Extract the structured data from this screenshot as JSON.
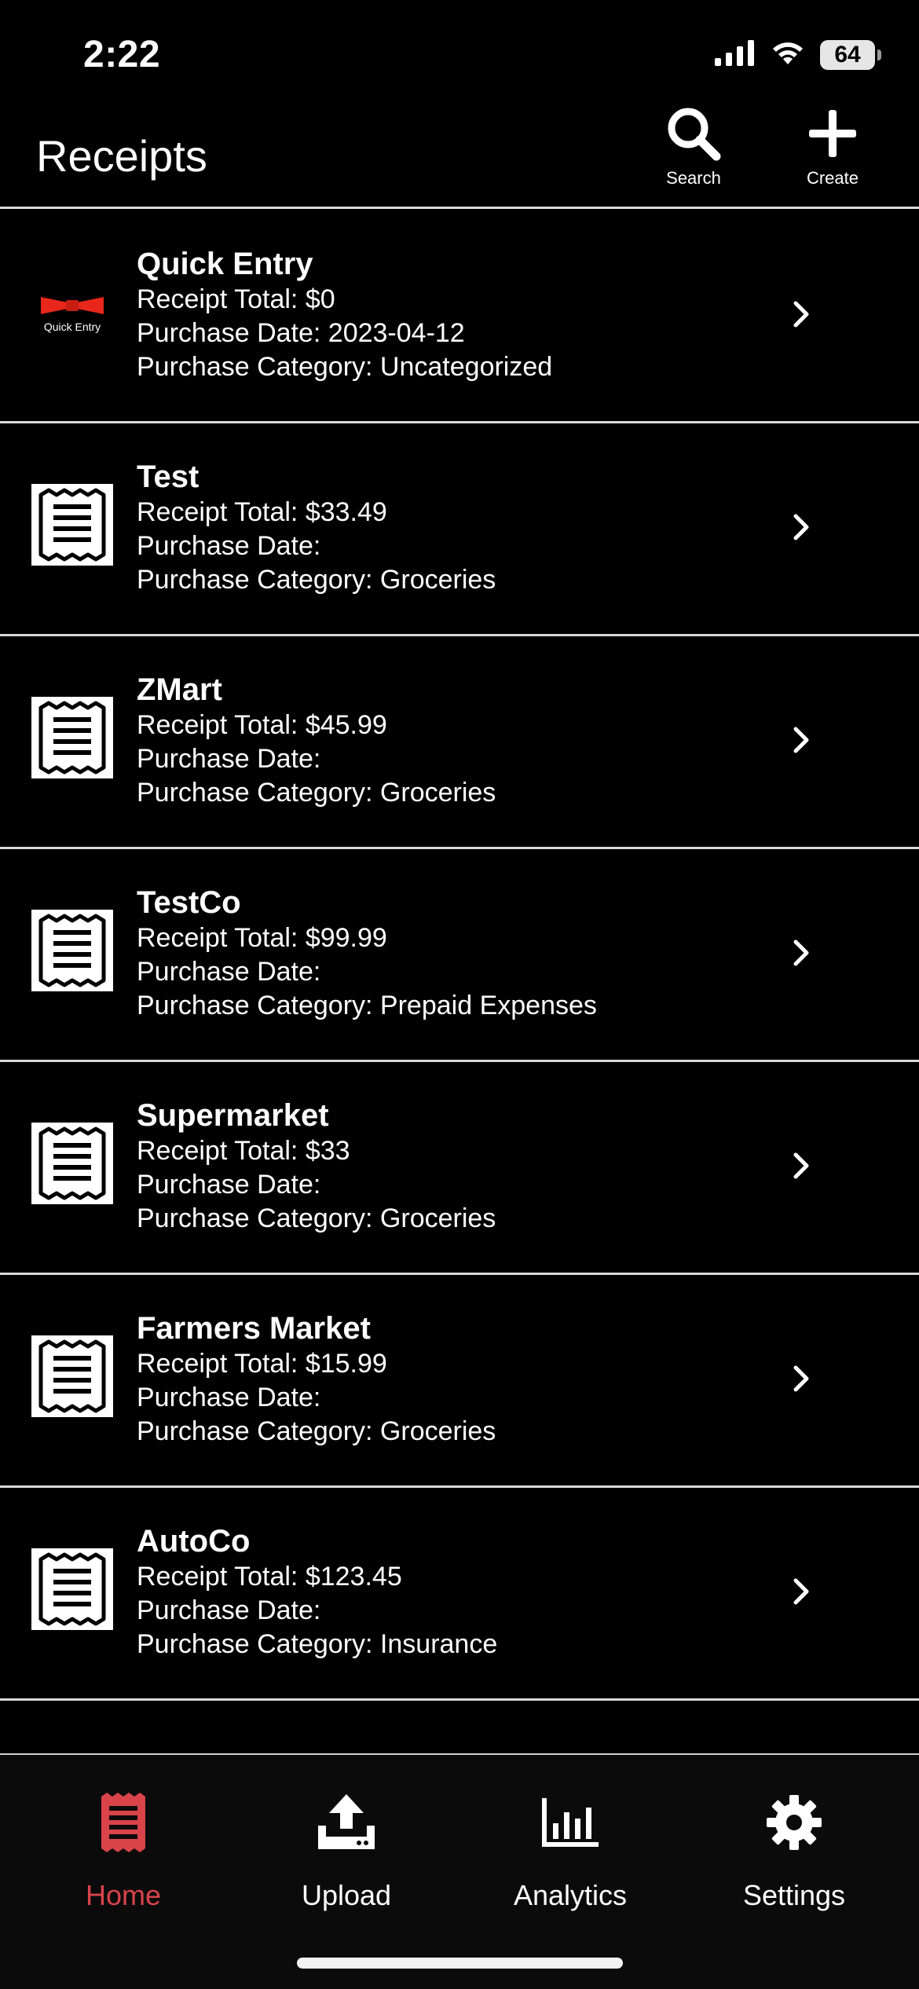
{
  "status_bar": {
    "time": "2:22",
    "battery_level": "64"
  },
  "header": {
    "title": "Receipts",
    "search_label": "Search",
    "create_label": "Create"
  },
  "receipts": [
    {
      "title": "Quick Entry",
      "total": "Receipt Total: $0",
      "date": "Purchase Date: 2023-04-12",
      "category": "Purchase Category: Uncategorized",
      "thumb": "quick-entry-logo",
      "logo_text": "Quick Entry"
    },
    {
      "title": "Test",
      "total": "Receipt Total: $33.49",
      "date": "Purchase Date:",
      "category": "Purchase Category: Groceries",
      "thumb": "receipt-icon"
    },
    {
      "title": "ZMart",
      "total": "Receipt Total: $45.99",
      "date": "Purchase Date:",
      "category": "Purchase Category: Groceries",
      "thumb": "receipt-icon"
    },
    {
      "title": "TestCo",
      "total": "Receipt Total: $99.99",
      "date": "Purchase Date:",
      "category": "Purchase Category: Prepaid Expenses",
      "thumb": "receipt-icon"
    },
    {
      "title": "Supermarket",
      "total": "Receipt Total: $33",
      "date": "Purchase Date:",
      "category": "Purchase Category: Groceries",
      "thumb": "receipt-icon"
    },
    {
      "title": "Farmers Market",
      "total": "Receipt Total: $15.99",
      "date": "Purchase Date:",
      "category": "Purchase Category: Groceries",
      "thumb": "receipt-icon"
    },
    {
      "title": "AutoCo",
      "total": "Receipt Total: $123.45",
      "date": "Purchase Date:",
      "category": "Purchase Category: Insurance",
      "thumb": "receipt-icon"
    }
  ],
  "tabs": {
    "home": "Home",
    "upload": "Upload",
    "analytics": "Analytics",
    "settings": "Settings"
  },
  "colors": {
    "background": "#000000",
    "accent": "#d9434a",
    "divider": "#d9d9d9",
    "logo_red": "#e8261a"
  }
}
